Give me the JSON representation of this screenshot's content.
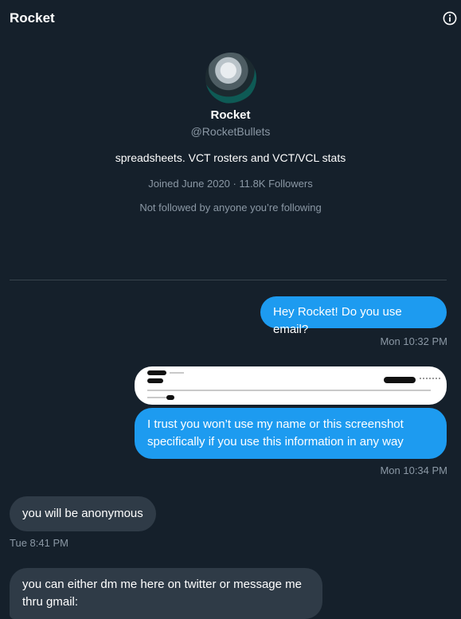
{
  "header": {
    "title": "Rocket"
  },
  "profile": {
    "name": "Rocket",
    "handle": "@RocketBullets",
    "bio": "spreadsheets. VCT rosters and VCT/VCL stats",
    "meta": "Joined June 2020 · 11.8K Followers",
    "followed_by": "Not followed by anyone you’re following"
  },
  "messages": [
    {
      "text": "Hey Rocket! Do you use email?",
      "time": "Mon 10:32 PM"
    },
    {
      "text": "I trust you won’t use my name or this screenshot specifically if you use this information in any way",
      "time": "Mon 10:34 PM"
    },
    {
      "text": "you will be anonymous",
      "time": "Tue 8:41 PM"
    },
    {
      "text": "you can either dm me here on twitter or message me thru gmail:"
    }
  ],
  "colors": {
    "background": "#15202b",
    "outgoing": "#1d9bf0",
    "incoming": "#2f3b47",
    "muted": "#8b98a5"
  },
  "icons": {
    "info": "info-icon"
  }
}
